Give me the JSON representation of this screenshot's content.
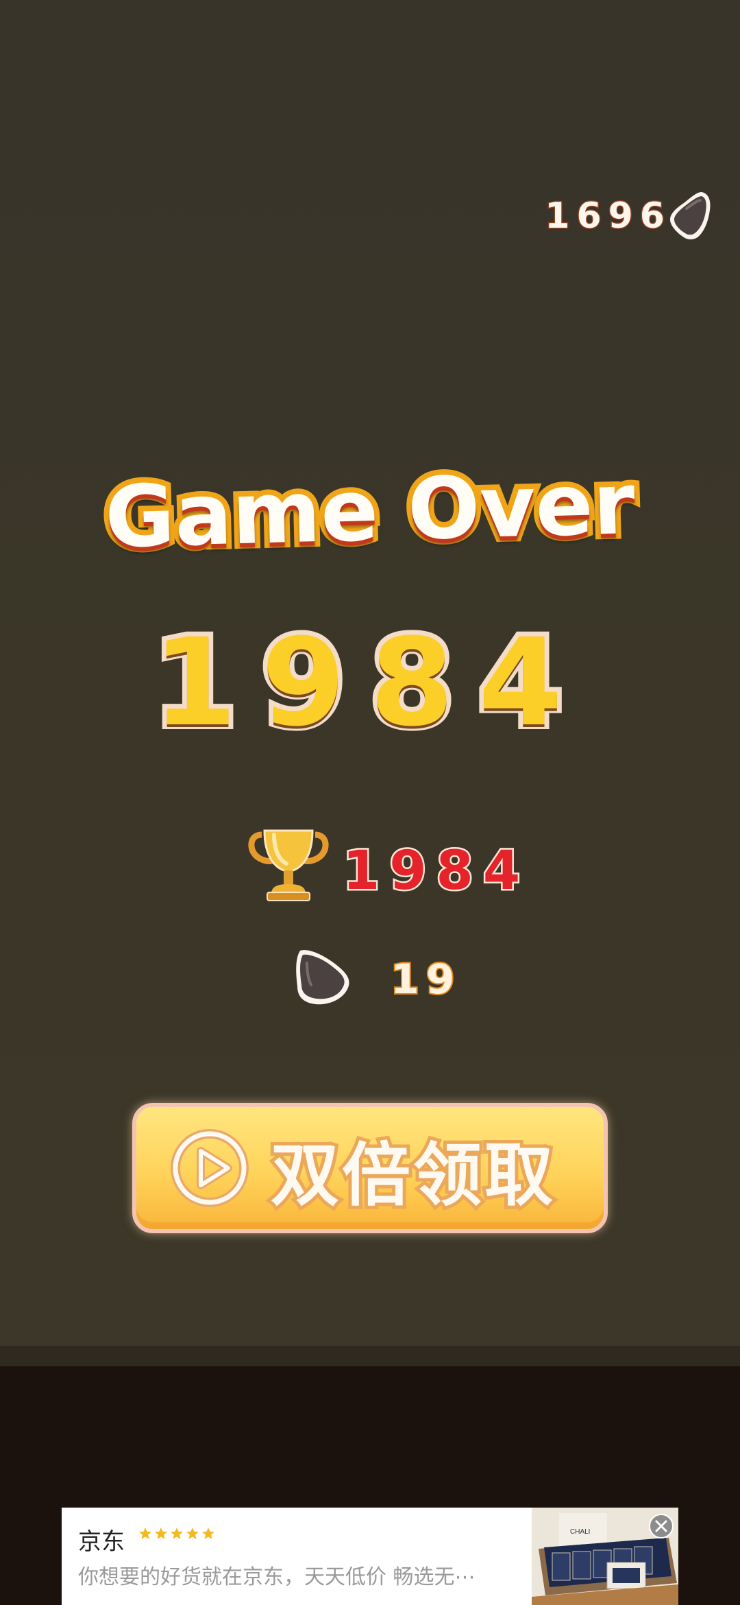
{
  "coins": {
    "total": "1696",
    "icon": "coin-icon"
  },
  "game_over": {
    "title": "Game Over",
    "score": "1984",
    "best_score": "1984",
    "best_icon": "trophy-icon",
    "coins_earned": "19",
    "coins_icon": "coin-icon"
  },
  "double_reward_button": {
    "label": "双倍领取",
    "icon": "play-circle-icon"
  },
  "ad": {
    "brand": "京东",
    "rating_stars": 5,
    "description": "你想要的好货就在京东，天天低价 畅选无⋯",
    "image_brand_text": "CHALI",
    "close_icon": "close-icon"
  },
  "colors": {
    "background": "#3a3528",
    "score_yellow": "#fcce28",
    "best_red": "#e4232a",
    "button_yellow": "#ffd35a",
    "title_orange": "#f0a519"
  }
}
